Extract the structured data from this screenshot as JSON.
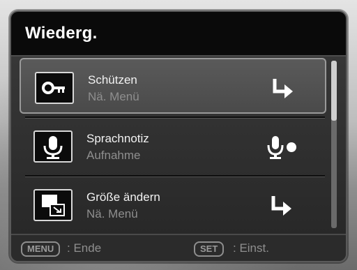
{
  "header": {
    "title": "Wiederg."
  },
  "menu": {
    "items": [
      {
        "label": "Schützen",
        "sub": "Nä. Menü",
        "icon": "key-icon",
        "action_icon": "enter-arrow-icon",
        "selected": true
      },
      {
        "label": "Sprachnotiz",
        "sub": "Aufnahme",
        "icon": "microphone-icon",
        "action_icon": "record-mic-icon",
        "selected": false
      },
      {
        "label": "Größe ändern",
        "sub": "Nä. Menü",
        "icon": "resize-icon",
        "action_icon": "enter-arrow-icon",
        "selected": false
      }
    ]
  },
  "footer": {
    "menu_key": "MENU",
    "menu_label": ": Ende",
    "set_key": "SET",
    "set_label": ": Einst."
  },
  "colors": {
    "panel": "#2b2b2b",
    "titlebar": "#0a0a0a",
    "selected_item": "#4f4f4f",
    "text": "#f2f2f2",
    "subtext": "#8f8f8f"
  }
}
